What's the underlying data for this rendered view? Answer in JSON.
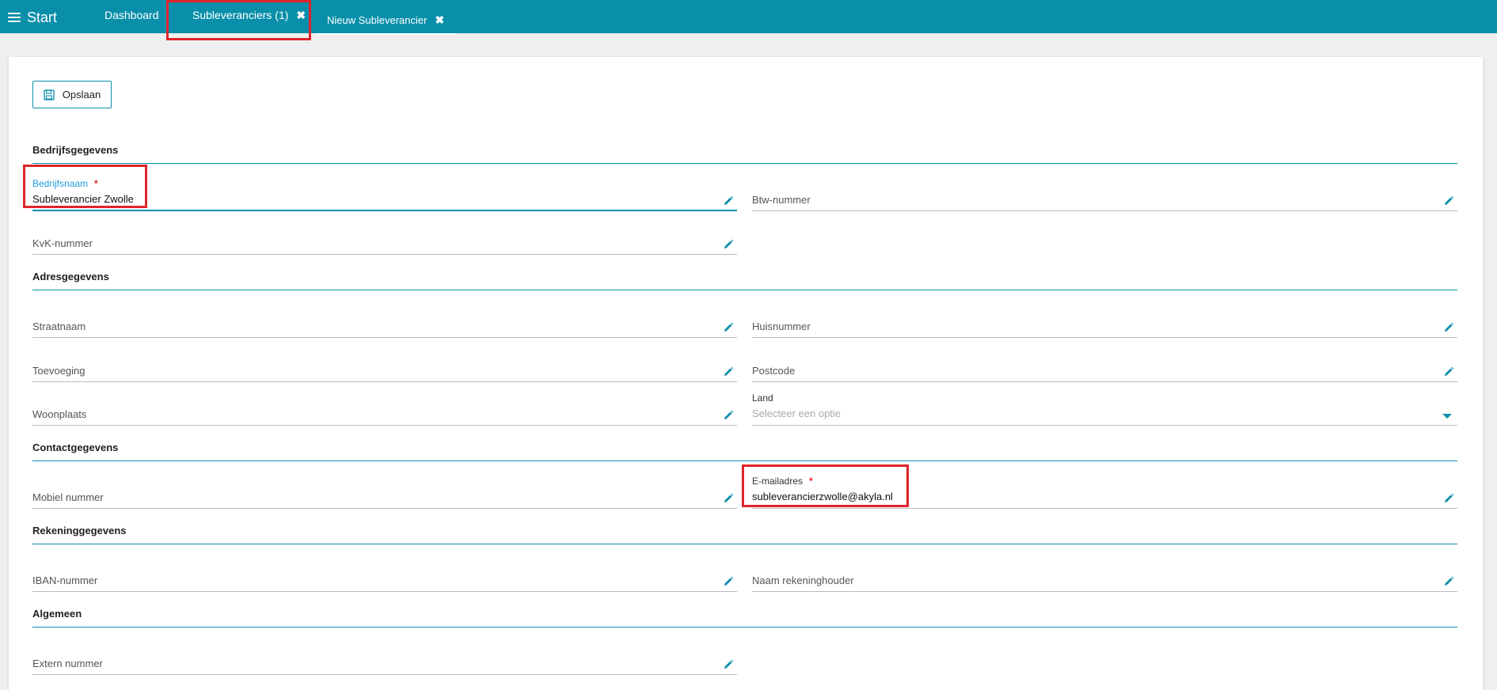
{
  "topbar": {
    "menu_label": "Start",
    "tabs": [
      {
        "label": "Dashboard"
      },
      {
        "label": "Subleveranciers (1)",
        "close": "✖"
      },
      {
        "label": "Nieuw Subleverancier",
        "close": "✖"
      }
    ]
  },
  "toolbar": {
    "save_label": "Opslaan"
  },
  "sections": {
    "bedrijf": "Bedrijfsgegevens",
    "adres": "Adresgegevens",
    "contact": "Contactgegevens",
    "rekening": "Rekeninggegevens",
    "algemeen": "Algemeen"
  },
  "fields": {
    "bedrijfsnaam": {
      "label": "Bedrijfsnaam",
      "required": "*",
      "value": "Subleverancier Zwolle"
    },
    "btw": {
      "label": "Btw-nummer"
    },
    "kvk": {
      "label": "KvK-nummer"
    },
    "straatnaam": {
      "label": "Straatnaam"
    },
    "huisnummer": {
      "label": "Huisnummer"
    },
    "toevoeging": {
      "label": "Toevoeging"
    },
    "postcode": {
      "label": "Postcode"
    },
    "woonplaats": {
      "label": "Woonplaats"
    },
    "land": {
      "label": "Land",
      "placeholder": "Selecteer een optie"
    },
    "mobiel": {
      "label": "Mobiel nummer"
    },
    "email": {
      "label": "E-mailadres",
      "required": "*",
      "value": "subleverancierzwolle@akyla.nl"
    },
    "iban": {
      "label": "IBAN-nummer"
    },
    "rekeninghouder": {
      "label": "Naam rekeninghouder"
    },
    "extern": {
      "label": "Extern nummer"
    }
  },
  "colors": {
    "accent": "#0a8faa",
    "highlight": "#e0242b",
    "required": "#e0242b"
  }
}
